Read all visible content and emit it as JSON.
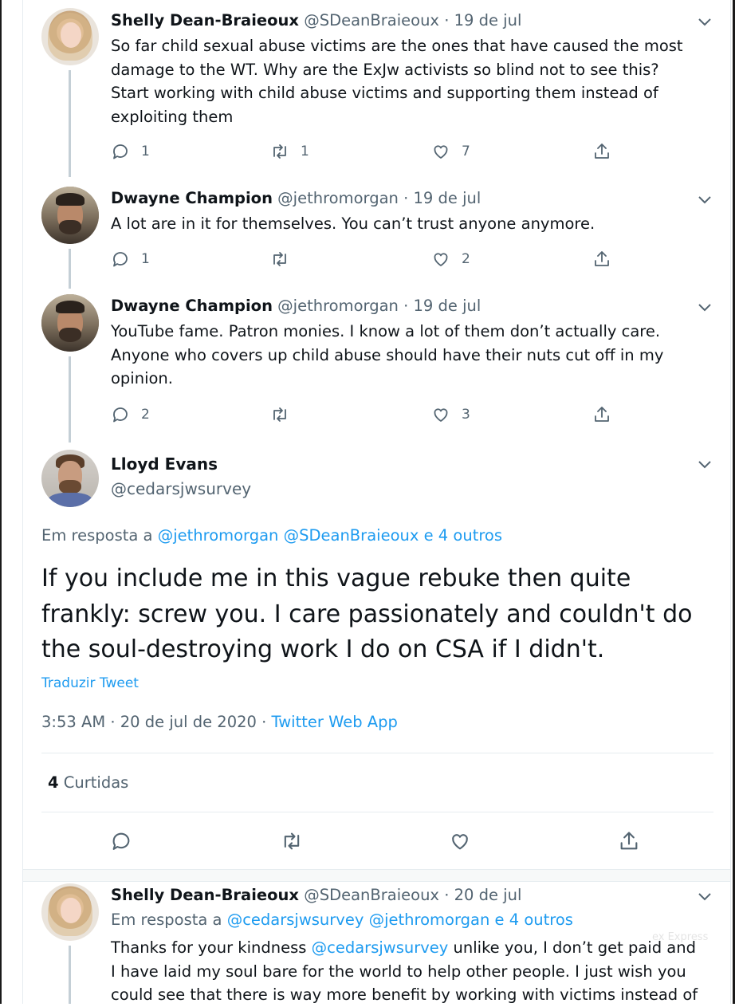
{
  "tweets": [
    {
      "name": "Shelly Dean-Braieoux",
      "handle": "@SDeanBraieoux",
      "sep": "·",
      "date": "19 de jul",
      "lines": [
        "So far child sexual abuse victims are the ones that have caused the most",
        "damage to the WT. Why are the ExJw activists so blind not to see this?",
        "Start working with child abuse victims and supporting them instead of",
        "exploiting them"
      ],
      "replies": "1",
      "retweets": "1",
      "likes": "7"
    },
    {
      "name": "Dwayne Champion",
      "handle": "@jethromorgan",
      "sep": "·",
      "date": "19 de jul",
      "lines": [
        "A lot are in it for themselves. You can’t trust anyone anymore."
      ],
      "replies": "1",
      "retweets": "",
      "likes": "2"
    },
    {
      "name": "Dwayne Champion",
      "handle": "@jethromorgan",
      "sep": "·",
      "date": "19 de jul",
      "lines": [
        "YouTube fame. Patron monies. I know a lot of them don’t actually care.",
        "Anyone who covers up child abuse should have their nuts cut off in my",
        "opinion."
      ],
      "replies": "2",
      "retweets": "",
      "likes": "3"
    }
  ],
  "main": {
    "name": "Lloyd Evans",
    "handle": "@cedarsjwsurvey",
    "reply_prefix": "Em resposta a",
    "reply_mentions": "@jethromorgan @SDeanBraieoux",
    "reply_others": "e 4 outros",
    "lines": [
      "If you include me in this vague rebuke then quite",
      "frankly: screw you. I care passionately and couldn't do",
      "the soul-destroying work I do on CSA if I didn't."
    ],
    "translate": "Traduzir Tweet",
    "time": "3:53 AM · 20 de jul de 2020 ·",
    "source": "Twitter Web App",
    "likes_count": "4",
    "likes_label": "Curtidas"
  },
  "reply": {
    "name": "Shelly Dean-Braieoux",
    "handle": "@SDeanBraieoux",
    "sep": "·",
    "date": "20 de jul",
    "reply_prefix": "Em resposta a",
    "reply_mentions": "@cedarsjwsurvey @jethromorgan",
    "reply_others": "e 4 outros",
    "line1_a": "Thanks for your kindness",
    "line1_mention": "@cedarsjwsurvey",
    "line1_b": "unlike you, I don’t get paid and",
    "line2": "I have laid my soul bare for the world to help other people. I just wish you",
    "line3": "could see that there is way more benefit by working with victims instead of"
  },
  "watermark": "ex Express",
  "colors": {
    "link": "#1d9bf0",
    "muted": "#536471",
    "text": "#0f1419",
    "divider": "#e6ecf0"
  },
  "icons": [
    "reply-icon",
    "retweet-icon",
    "like-icon",
    "share-icon",
    "chevron-down-icon"
  ]
}
